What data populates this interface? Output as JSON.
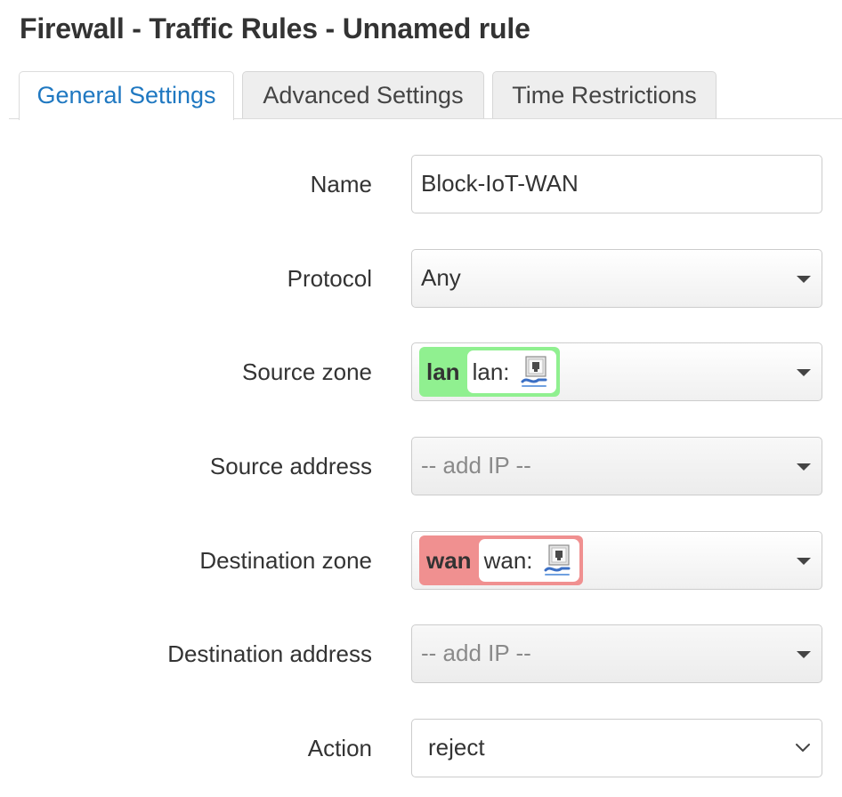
{
  "page": {
    "title": "Firewall - Traffic Rules - Unnamed rule"
  },
  "tabs": [
    {
      "label": "General Settings",
      "active": true
    },
    {
      "label": "Advanced Settings",
      "active": false
    },
    {
      "label": "Time Restrictions",
      "active": false
    }
  ],
  "form": {
    "name": {
      "label": "Name",
      "value": "Block-IoT-WAN"
    },
    "protocol": {
      "label": "Protocol",
      "value": "Any"
    },
    "source_zone": {
      "label": "Source zone",
      "zone": "lan",
      "network": "lan:",
      "color": "#90f090",
      "icon": "ethernet-port-icon"
    },
    "source_address": {
      "label": "Source address",
      "placeholder": "-- add IP --"
    },
    "destination_zone": {
      "label": "Destination zone",
      "zone": "wan",
      "network": "wan:",
      "color": "#f09090",
      "icon": "ethernet-port-icon"
    },
    "destination_address": {
      "label": "Destination address",
      "placeholder": "-- add IP --"
    },
    "action": {
      "label": "Action",
      "value": "reject"
    }
  },
  "colors": {
    "active_tab_text": "#1f78c1",
    "lan_zone": "#90f090",
    "wan_zone": "#f09090"
  }
}
